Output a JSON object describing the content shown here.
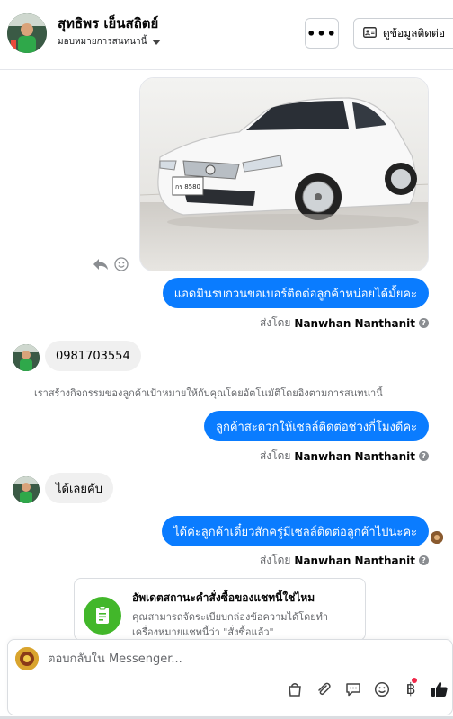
{
  "header": {
    "name": "สุทธิพร เย็นสถิตย์",
    "assign_label": "มอบหมายการสนทนานี้",
    "more_label": "•••",
    "contact_label": "ดูข้อมูลติดต่อ"
  },
  "messages": [
    {
      "kind": "outgoing",
      "text": "แอดมินรบกวนขอเบอร์ติดต่อลูกค้าหน่อยได้มั้ยคะ"
    },
    {
      "kind": "incoming",
      "text": "0981703554"
    },
    {
      "kind": "incoming",
      "text": "ได้เลยคับ"
    },
    {
      "kind": "outgoing",
      "text": "ลูกค้าสะดวกให้เซลล์ติดต่อช่วงกี่โมงดีคะ"
    },
    {
      "kind": "outgoing",
      "text": "ได้ค่ะลูกค้าเดี๋ยวสักครู่มีเซลล์ติดต่อลูกค้าไปนะคะ"
    }
  ],
  "sent_by": {
    "prefix": "ส่งโดย",
    "name": "Nanwhan Nanthanit",
    "help_glyph": "?"
  },
  "system_note": "เราสร้างกิจกรรมของลูกค้าเป้าหมายให้กับคุณโดยอัตโนมัติโดยอิงตามการสนทนานี้",
  "photo": {
    "plate": "กร 8580",
    "icon": "car-photo"
  },
  "card": {
    "title": "อัพเดตสถานะคำสั่งซื้อของแชทนี้ใช่ไหม",
    "body": "คุณสามารถจัดระเบียบกล่องข้อความได้โดยทำเครื่องหมายแชทนี้ว่า \"สั่งซื้อแล้ว\"",
    "icon": "order-form-icon"
  },
  "composer": {
    "placeholder": "ตอบกลับใน Messenger...",
    "tools": [
      "shopping-bag-icon",
      "paperclip-icon",
      "saved-reply-icon",
      "emoji-icon",
      "baht-icon",
      "thumbs-up-icon"
    ],
    "baht_glyph": "฿"
  },
  "colors": {
    "accent": "#0a7cff",
    "incoming_bg": "#f0f0f0",
    "card_icon_bg": "#42b72a",
    "like": "#0a1e3c"
  }
}
